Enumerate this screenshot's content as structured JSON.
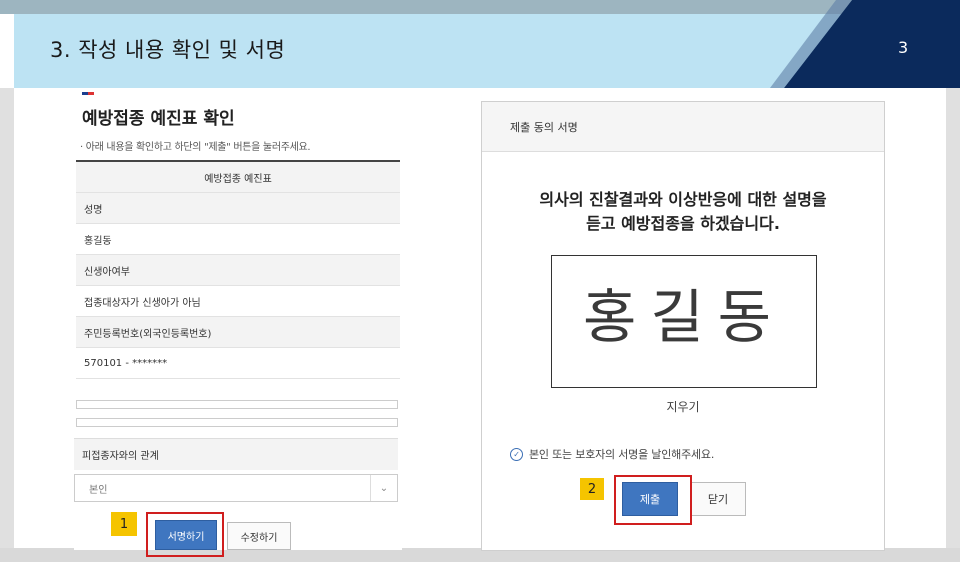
{
  "header": {
    "title": "3. 작성 내용 확인 및 서명",
    "page_number": "3"
  },
  "left_form": {
    "title": "예방접종 예진표 확인",
    "instruction": "· 아래 내용을 확인하고 하단의 \"제출\" 버튼을 눌러주세요.",
    "table_header": "예방접종 예진표",
    "rows": [
      {
        "label": "성명",
        "value": "홍길동"
      },
      {
        "label": "신생아여부",
        "value": "접종대상자가 신생아가 아님"
      },
      {
        "label": "주민등록번호(외국인등록번호)",
        "value": "570101 - *******"
      }
    ],
    "relation_label": "피접종자와의 관계",
    "relation_value": "본인",
    "sign_button": "서명하기",
    "edit_button": "수정하기",
    "step_tag": "1"
  },
  "right_modal": {
    "title": "제출 동의 서명",
    "message_line1": "의사의 진찰결과와 이상반응에 대한 설명을",
    "message_line2": "듣고 예방접종을 하겠습니다.",
    "signature_text": "홍길동",
    "clear_label": "지우기",
    "note": "본인 또는 보호자의 서명을 날인해주세요.",
    "submit_button": "제출",
    "close_button": "닫기",
    "step_tag": "2"
  },
  "colors": {
    "header_bg": "#bde3f3",
    "corner_navy": "#0b2a5c",
    "primary_button": "#3f76c0",
    "highlight_red": "#d01e1e",
    "tag_yellow": "#f5c400"
  }
}
